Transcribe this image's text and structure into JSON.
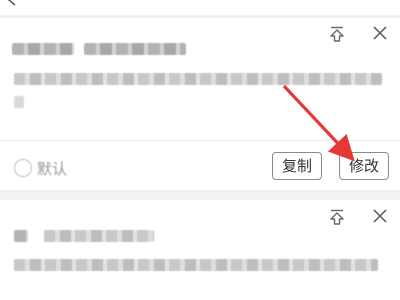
{
  "icons": {
    "back": "back-arrow-icon",
    "pin": "pin-to-top-icon",
    "close": "close-icon"
  },
  "colors": {
    "annotation_arrow": "#e53935",
    "button_border": "#8a8a8a",
    "page_background": "#f2f2f2"
  },
  "card1": {
    "default_label": "默认",
    "copy_label": "复制",
    "edit_label": "修改"
  },
  "card2": {}
}
